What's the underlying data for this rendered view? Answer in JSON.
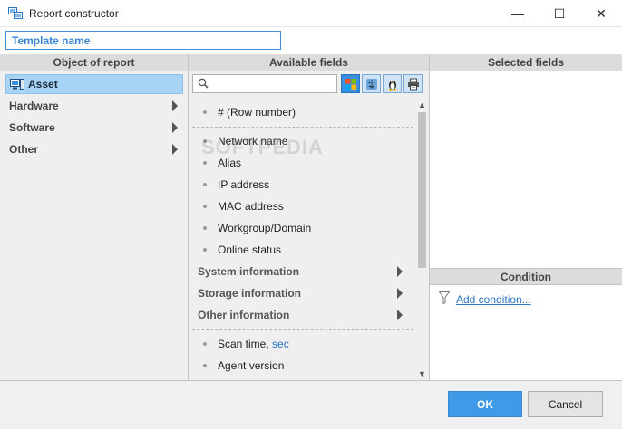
{
  "window": {
    "title": "Report constructor",
    "minimize_icon": "minimize-icon",
    "maximize_icon": "maximize-icon",
    "close_icon": "close-icon",
    "minimize_glyph": "—",
    "maximize_glyph": "☐",
    "close_glyph": "✕"
  },
  "template": {
    "placeholder": "Template name",
    "value": ""
  },
  "panels": {
    "object_header": "Object of report",
    "available_header": "Available fields",
    "selected_header": "Selected fields",
    "condition_header": "Condition"
  },
  "object_items": [
    {
      "label": "Asset",
      "selected": true,
      "icon": "computer-icon"
    },
    {
      "label": "Hardware",
      "has_submenu": true
    },
    {
      "label": "Software",
      "has_submenu": true
    },
    {
      "label": "Other",
      "has_submenu": true
    }
  ],
  "available": {
    "search_placeholder": "",
    "os_filters": [
      {
        "name": "windows-icon",
        "active": true
      },
      {
        "name": "mac-icon",
        "active": false
      },
      {
        "name": "linux-icon",
        "active": false
      },
      {
        "name": "printer-icon",
        "active": false
      }
    ],
    "fields_top": [
      "# (Row number)"
    ],
    "fields_main": [
      "Network name",
      "Alias",
      "IP address",
      "MAC address",
      "Workgroup/Domain",
      "Online status"
    ],
    "groups": [
      "System information",
      "Storage information",
      "Other information"
    ],
    "fields_bottom": [
      {
        "label": "Scan time, ",
        "unit": "sec"
      },
      {
        "label": "Agent version",
        "unit": ""
      }
    ]
  },
  "condition": {
    "add_label": "Add condition..."
  },
  "buttons": {
    "ok": "OK",
    "cancel": "Cancel"
  },
  "watermark": "SOFTPEDIA",
  "colors": {
    "accent": "#3f9ae8",
    "selection": "#a7d3f5",
    "link": "#2a76c6",
    "panel_bg": "#efefef",
    "header_bg": "#dcdcdc"
  }
}
